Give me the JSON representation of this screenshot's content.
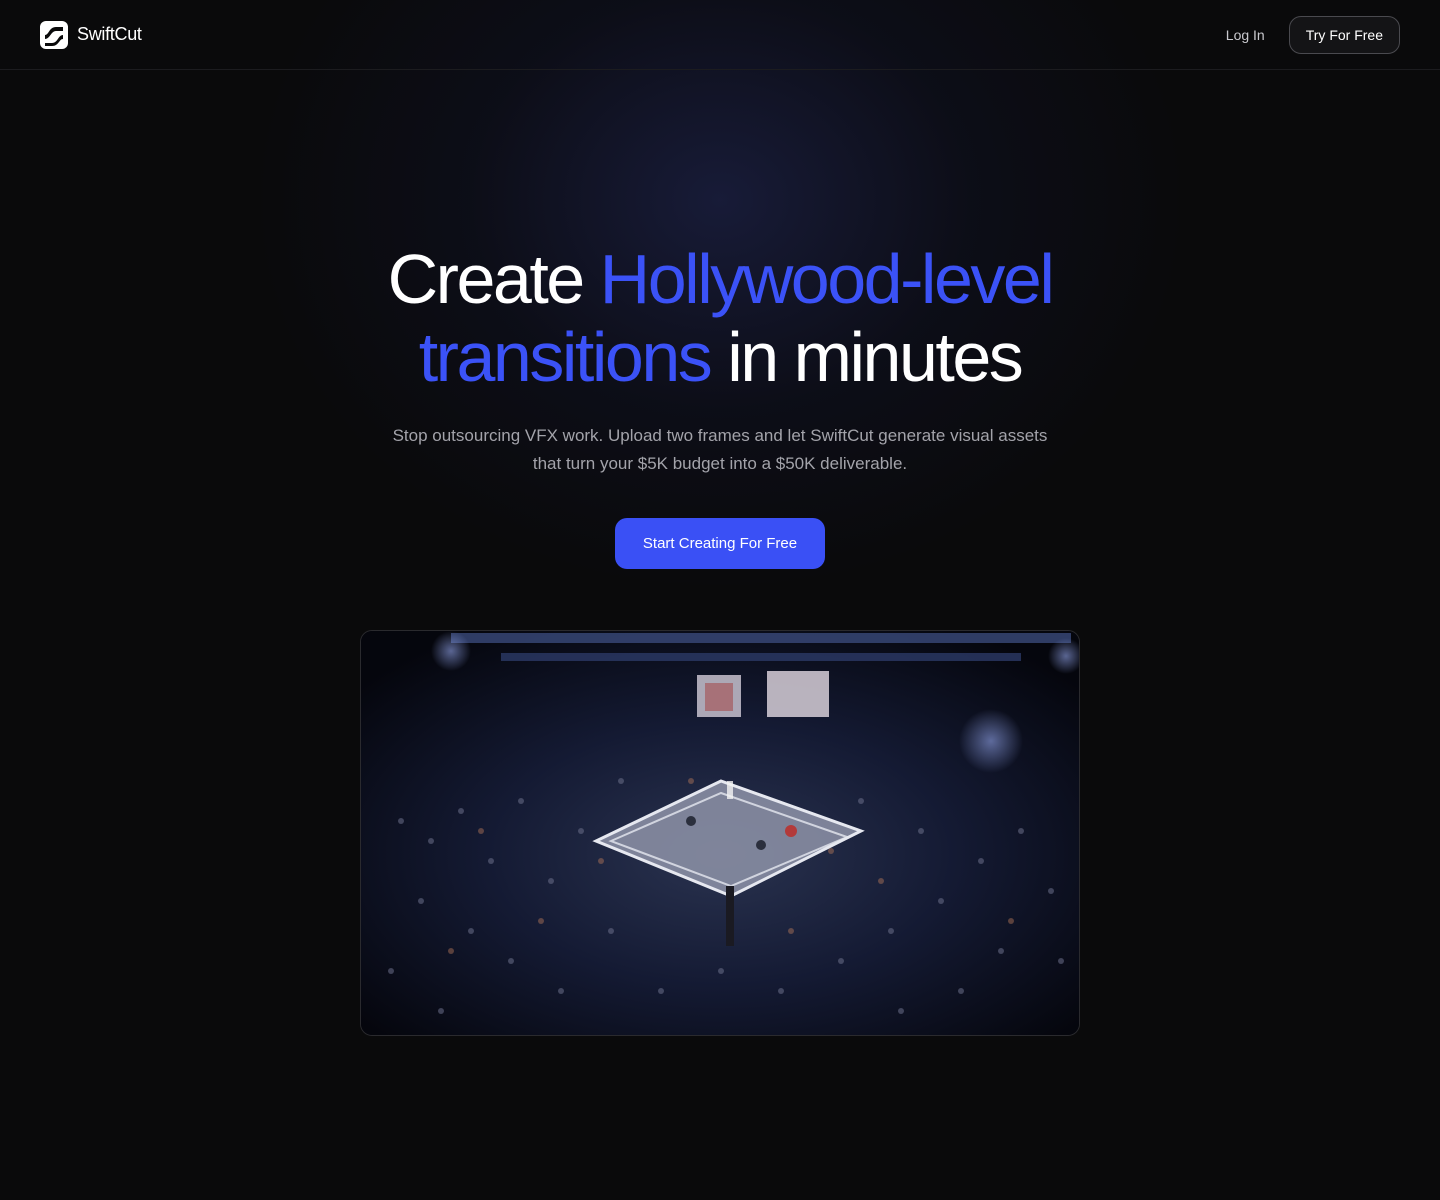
{
  "header": {
    "brand_name": "SwiftCut",
    "brand_icon": "swiftcut-logo-icon",
    "login_label": "Log In",
    "try_label": "Try For Free"
  },
  "hero": {
    "title_part1": "Create ",
    "title_accent1": "Hollywood-level",
    "title_accent2": "transitions",
    "title_part2": " in minutes",
    "subtitle": "Stop outsourcing VFX work. Upload two frames and let SwiftCut generate visual assets that turn your $5K budget into a $50K deliverable.",
    "cta_label": "Start Creating For Free"
  },
  "media": {
    "description_icon": "boxing-arena-image"
  },
  "colors": {
    "background": "#0a0a0b",
    "accent": "#3b52f7",
    "cta": "#3a50f5",
    "muted_text": "#a3a3aa"
  }
}
